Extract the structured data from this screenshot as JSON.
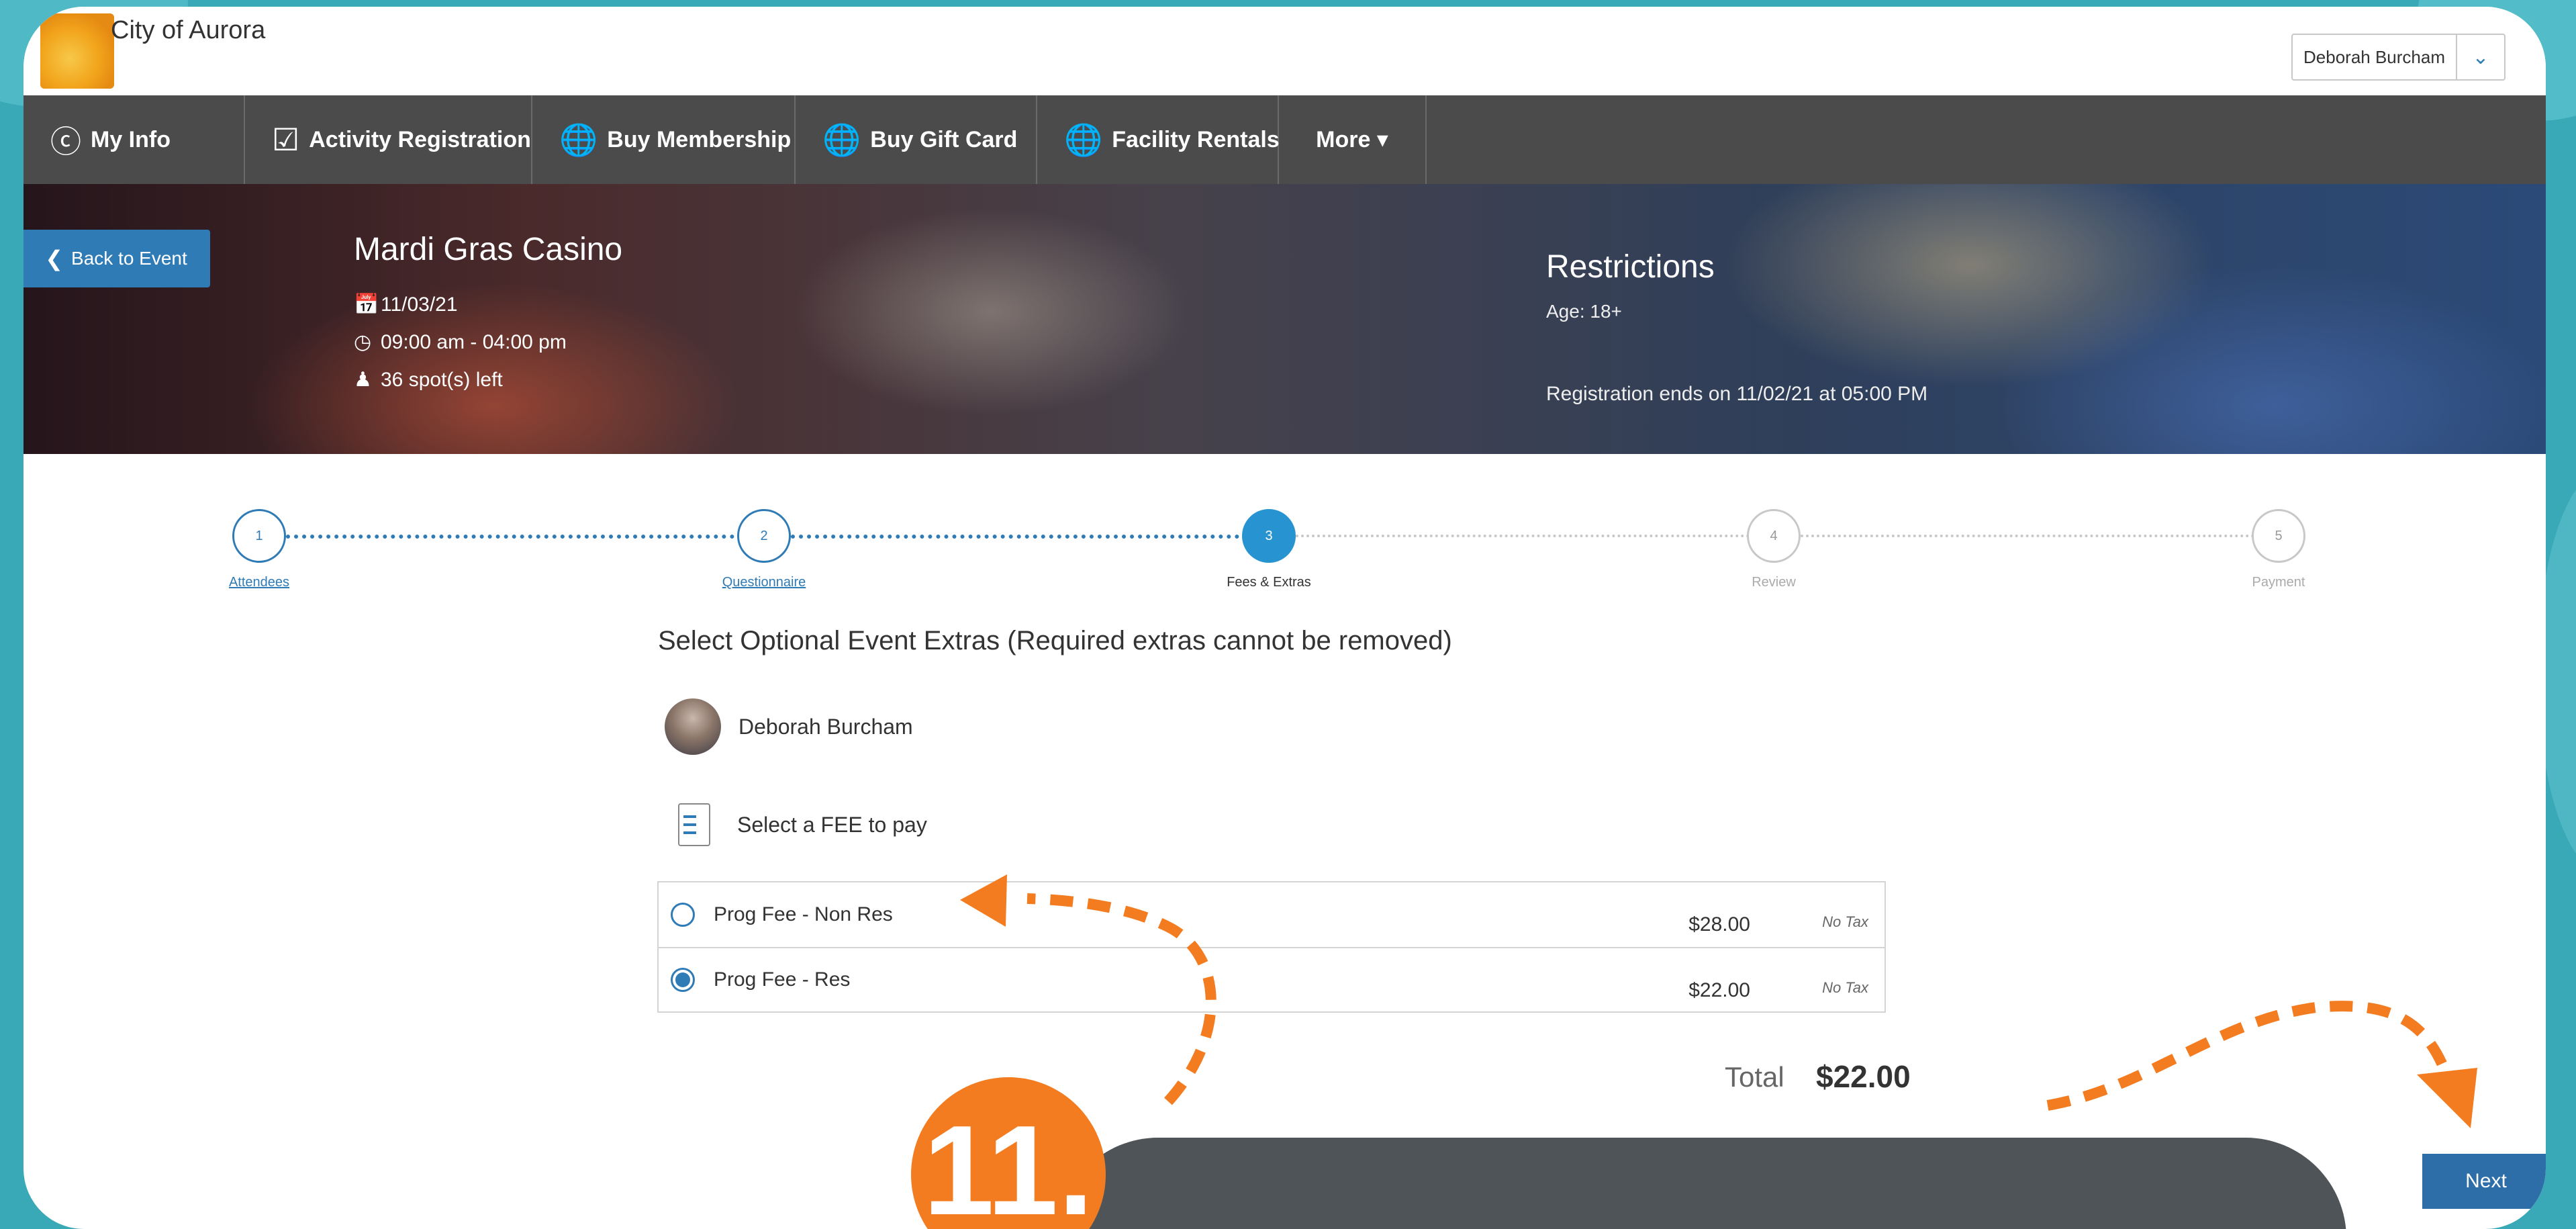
{
  "app": {
    "city_name": "City of Aurora"
  },
  "user_menu": {
    "name": "Deborah Burcham"
  },
  "nav": {
    "items": [
      {
        "label": "My Info",
        "icon": "user-circle-icon"
      },
      {
        "label": "Activity Registration",
        "icon": "calendar-check-icon"
      },
      {
        "label": "Buy Membership",
        "icon": "globe-icon"
      },
      {
        "label": "Buy Gift Card",
        "icon": "globe-icon"
      },
      {
        "label": "Facility Rentals",
        "icon": "globe-icon"
      },
      {
        "label": "More ▾",
        "icon": ""
      }
    ]
  },
  "hero": {
    "back_label": "Back to Event",
    "event_title": "Mardi Gras Casino",
    "date": "11/03/21",
    "time": "09:00 am - 04:00 pm",
    "spots": "36 spot(s) left",
    "restrictions_title": "Restrictions",
    "age": "Age: 18+",
    "registration_ends": "Registration ends on 11/02/21 at 05:00 PM"
  },
  "stepper": {
    "current_step": 3,
    "steps": [
      {
        "num": "1",
        "label": "Attendees",
        "state": "done"
      },
      {
        "num": "2",
        "label": "Questionnaire",
        "state": "done"
      },
      {
        "num": "3",
        "label": "Fees & Extras",
        "state": "current"
      },
      {
        "num": "4",
        "label": "Review",
        "state": "future"
      },
      {
        "num": "5",
        "label": "Payment",
        "state": "future"
      }
    ]
  },
  "content": {
    "heading": "Select Optional Event Extras (Required extras cannot be removed)",
    "attendee_name": "Deborah Burcham",
    "fee_prompt": "Select a FEE to pay",
    "fees": [
      {
        "name": "Prog Fee - Non Res",
        "price": "$28.00",
        "tax": "No Tax",
        "selected": false
      },
      {
        "name": "Prog Fee - Res",
        "price": "$22.00",
        "tax": "No Tax",
        "selected": true
      }
    ],
    "total_label": "Total",
    "total_value": "$22.00"
  },
  "actions": {
    "next_label": "Next"
  },
  "tutorial": {
    "step_badge": "11."
  },
  "colors": {
    "nav_bg": "#4b4b4b",
    "accent_blue": "#2f7bb6",
    "tutorial_orange": "#f47c20",
    "page_bg": "#3aa9b7"
  }
}
